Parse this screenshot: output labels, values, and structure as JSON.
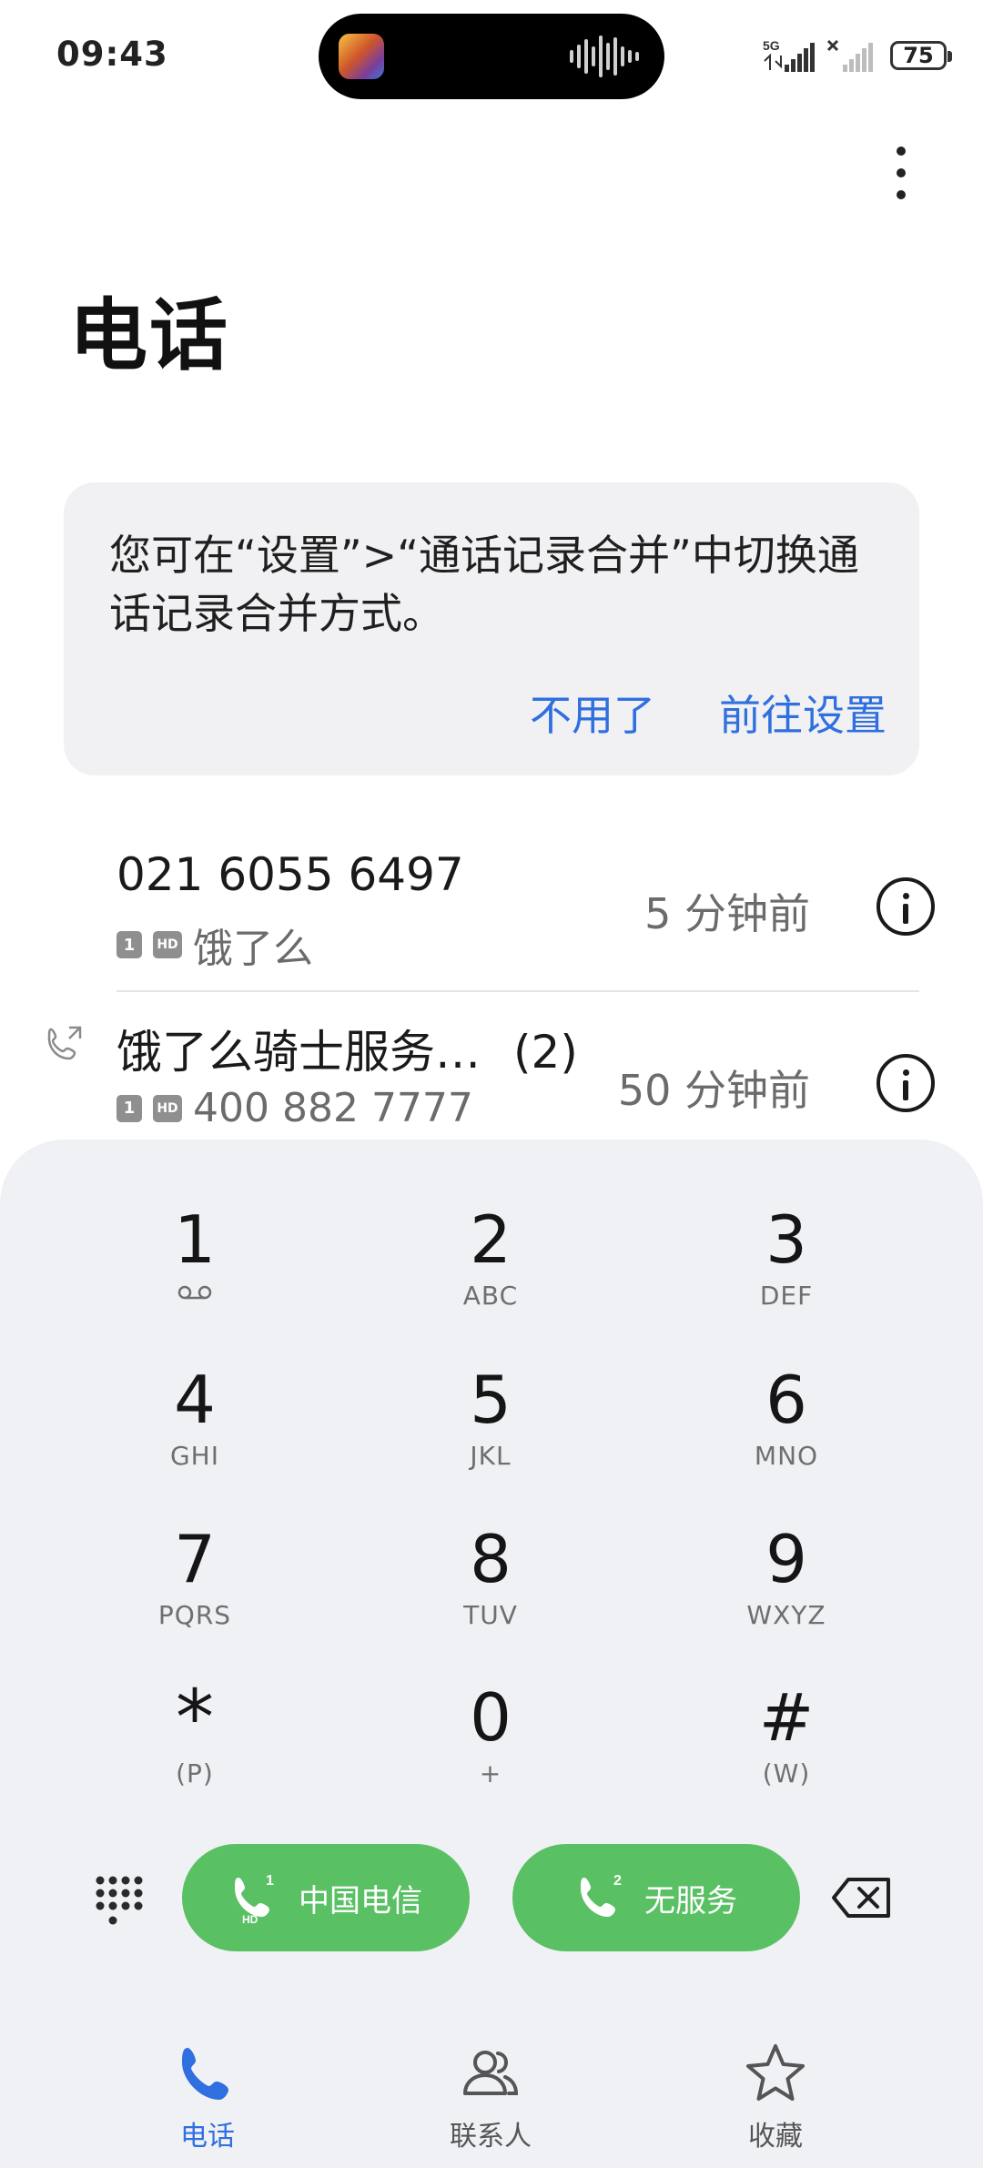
{
  "status_bar": {
    "time": "09:43",
    "network": "5G",
    "battery": "75"
  },
  "header": {
    "title": "电话"
  },
  "tip_card": {
    "message": "您可在“设置”>“通话记录合并”中切换通话记录合并方式。",
    "dismiss_label": "不用了",
    "settings_label": "前往设置",
    "accent_color": "#2f6fdf"
  },
  "call_log": [
    {
      "name": "021 6055 6497",
      "count": "",
      "sim": "1",
      "hd": "HD",
      "detail": "饿了么",
      "time": "5 分钟前",
      "direction": "incoming"
    },
    {
      "name": "饿了么骑士服务…",
      "count": "(2)",
      "sim": "1",
      "hd": "HD",
      "detail": "400 882 7777",
      "time": "50 分钟前",
      "direction": "outgoing"
    }
  ],
  "dialpad": {
    "keys": [
      {
        "digit": "1",
        "sub": ""
      },
      {
        "digit": "2",
        "sub": "ABC"
      },
      {
        "digit": "3",
        "sub": "DEF"
      },
      {
        "digit": "4",
        "sub": "GHI"
      },
      {
        "digit": "5",
        "sub": "JKL"
      },
      {
        "digit": "6",
        "sub": "MNO"
      },
      {
        "digit": "7",
        "sub": "PQRS"
      },
      {
        "digit": "8",
        "sub": "TUV"
      },
      {
        "digit": "9",
        "sub": "WXYZ"
      },
      {
        "digit": "*",
        "sub": "(P)"
      },
      {
        "digit": "0",
        "sub": "+"
      },
      {
        "digit": "#",
        "sub": "(W)"
      }
    ],
    "call_buttons": [
      {
        "sim": "1",
        "hd": "HD",
        "label": "中国电信"
      },
      {
        "sim": "2",
        "hd": "",
        "label": "无服务"
      }
    ],
    "call_color": "#5ac064"
  },
  "bottom_nav": [
    {
      "label": "电话",
      "icon": "phone-icon",
      "active": true
    },
    {
      "label": "联系人",
      "icon": "contacts-icon",
      "active": false
    },
    {
      "label": "收藏",
      "icon": "star-icon",
      "active": false
    }
  ]
}
